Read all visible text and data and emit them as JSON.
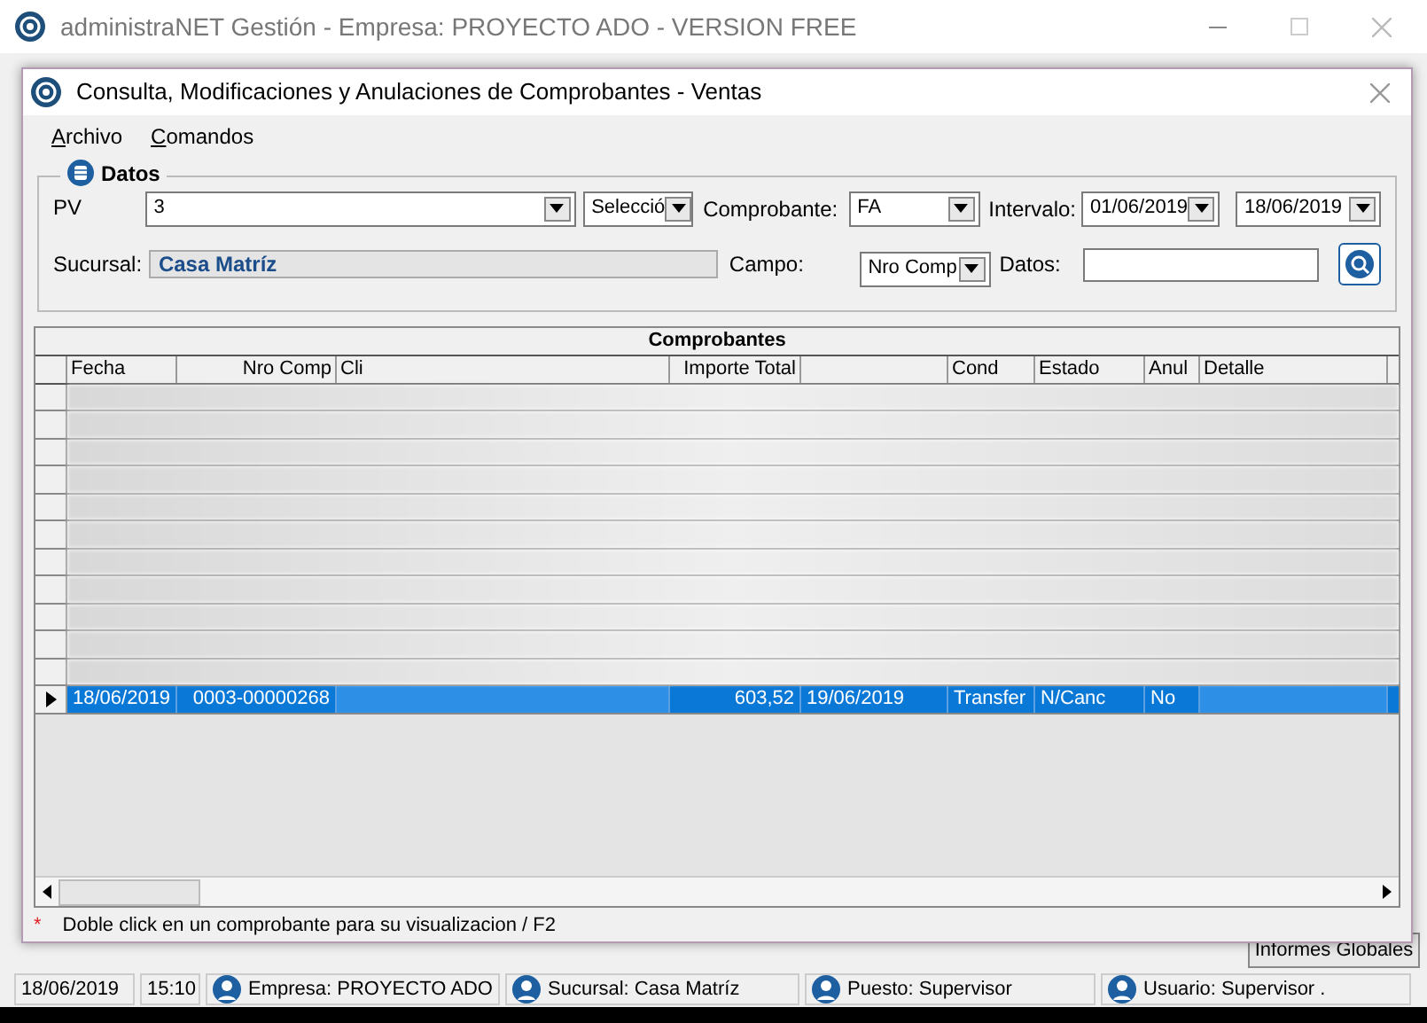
{
  "app_window": {
    "title": "administraNET Gestión - Empresa: PROYECTO ADO - VERSION FREE",
    "button": "Informes Globales"
  },
  "dialog": {
    "title": "Consulta, Modificaciones y Anulaciones de Comprobantes - Ventas",
    "menu": [
      {
        "label": "Archivo"
      },
      {
        "label": "Comandos"
      }
    ],
    "datos": {
      "title": "Datos",
      "pv_label": "PV",
      "pv_value": "3",
      "selector": "Selecció",
      "comprobante_label": "Comprobante:",
      "comprobante_value": "FA",
      "intervalo_label": "Intervalo:",
      "date_from": "01/06/2019",
      "date_to": "18/06/2019",
      "sucursal_label": "Sucursal:",
      "sucursal_value": "Casa Matríz",
      "campo_label": "Campo:",
      "campo_value": "Nro Comp",
      "datos_label": "Datos:"
    },
    "table": {
      "title": "Comprobantes",
      "columns": [
        "Fecha",
        "Nro Comp",
        "Cli",
        "Importe Total",
        null,
        "Cond",
        "Estado",
        "Anul",
        "Detalle"
      ],
      "rows": [
        {
          "kind": "redacted",
          "selected": false
        },
        {
          "kind": "redacted",
          "selected": false
        },
        {
          "kind": "redacted",
          "selected": false
        },
        {
          "kind": "redacted",
          "selected": false
        },
        {
          "kind": "redacted",
          "selected": false
        },
        {
          "kind": "redacted",
          "selected": false
        },
        {
          "kind": "redacted",
          "selected": false
        },
        {
          "kind": "redacted",
          "selected": false
        },
        {
          "kind": "redacted",
          "selected": false
        },
        {
          "kind": "redacted",
          "selected": false
        },
        {
          "kind": "redacted",
          "selected": false
        },
        {
          "kind": "data",
          "selected": true,
          "cells": [
            "18/06/2019",
            "0003-00000268",
            null,
            "603,52",
            "19/06/2019",
            "Transfer",
            "N/Canc",
            "No",
            null
          ]
        }
      ]
    },
    "note": {
      "mark": "*",
      "text": "Doble click en un comprobante para su visualizacion / F2"
    }
  },
  "status_bar": [
    {
      "kind": "text",
      "text": "18/06/2019"
    },
    {
      "kind": "text",
      "text": "15:10"
    },
    {
      "kind": "icon",
      "text": "Empresa: PROYECTO ADO"
    },
    {
      "kind": "icon",
      "text": "Sucursal: Casa Matríz"
    },
    {
      "kind": "icon",
      "text": "Puesto: Supervisor"
    },
    {
      "kind": "icon",
      "text": "Usuario: Supervisor ."
    }
  ]
}
